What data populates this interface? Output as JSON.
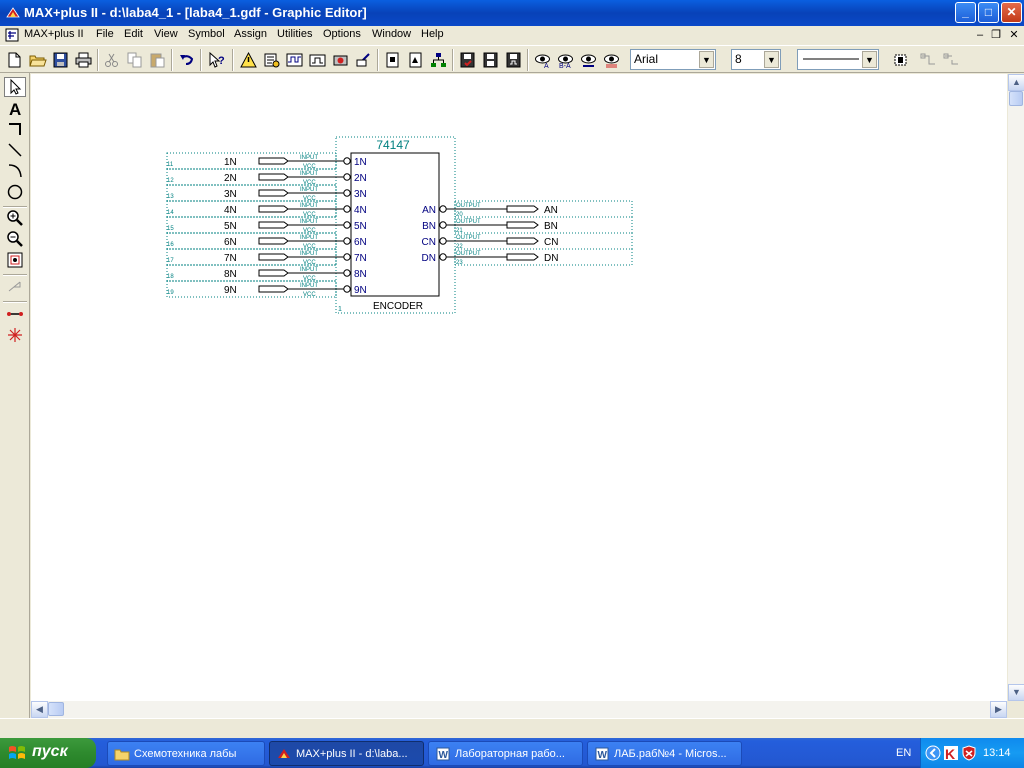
{
  "window": {
    "title": "MAX+plus II - d:\\laba4_1 - [laba4_1.gdf - Graphic Editor]",
    "min": "_",
    "max": "□",
    "close": "✕"
  },
  "menu": {
    "items": [
      "MAX+plus II",
      "File",
      "Edit",
      "View",
      "Symbol",
      "Assign",
      "Utilities",
      "Options",
      "Window",
      "Help"
    ],
    "mdi_min": "–",
    "mdi_restore": "❐",
    "mdi_close": "✕"
  },
  "toolbar": {
    "font_name": "Arial",
    "font_size": "8",
    "arrow": "▼"
  },
  "schematic": {
    "chip_name": "74147",
    "chip_footer": "ENCODER",
    "chip_id": "1",
    "input_pins": [
      "1N",
      "2N",
      "3N",
      "4N",
      "5N",
      "6N",
      "7N",
      "8N",
      "9N"
    ],
    "input_labels": [
      "1N",
      "2N",
      "3N",
      "4N",
      "5N",
      "6N",
      "7N",
      "8N",
      "9N"
    ],
    "input_numbers": [
      "11",
      "12",
      "13",
      "14",
      "15",
      "16",
      "17",
      "18",
      "19"
    ],
    "input_tag_top": "INPUT",
    "input_tag_bottom": "VCC",
    "output_pins": [
      "AN",
      "BN",
      "CN",
      "DN"
    ],
    "output_labels": [
      "AN",
      "BN",
      "CN",
      "DN"
    ],
    "output_numbers": [
      "20",
      "21",
      "22",
      "23"
    ],
    "output_tag": "OUTPUT"
  },
  "taskbar": {
    "start": "пуск",
    "tasks": [
      "Схемотехника лабы",
      "MAX+plus II - d:\\laba...",
      "Лабораторная рабо...",
      "ЛАБ.раб№4 - Micros..."
    ],
    "lang": "EN",
    "clock": "13:14"
  },
  "scroll": {
    "up": "▲",
    "down": "▼",
    "left": "◀",
    "right": "▶"
  },
  "colors": {
    "title_blue": "#0A49C8",
    "schematic_teal": "#008080",
    "pin_navy": "#000080"
  }
}
